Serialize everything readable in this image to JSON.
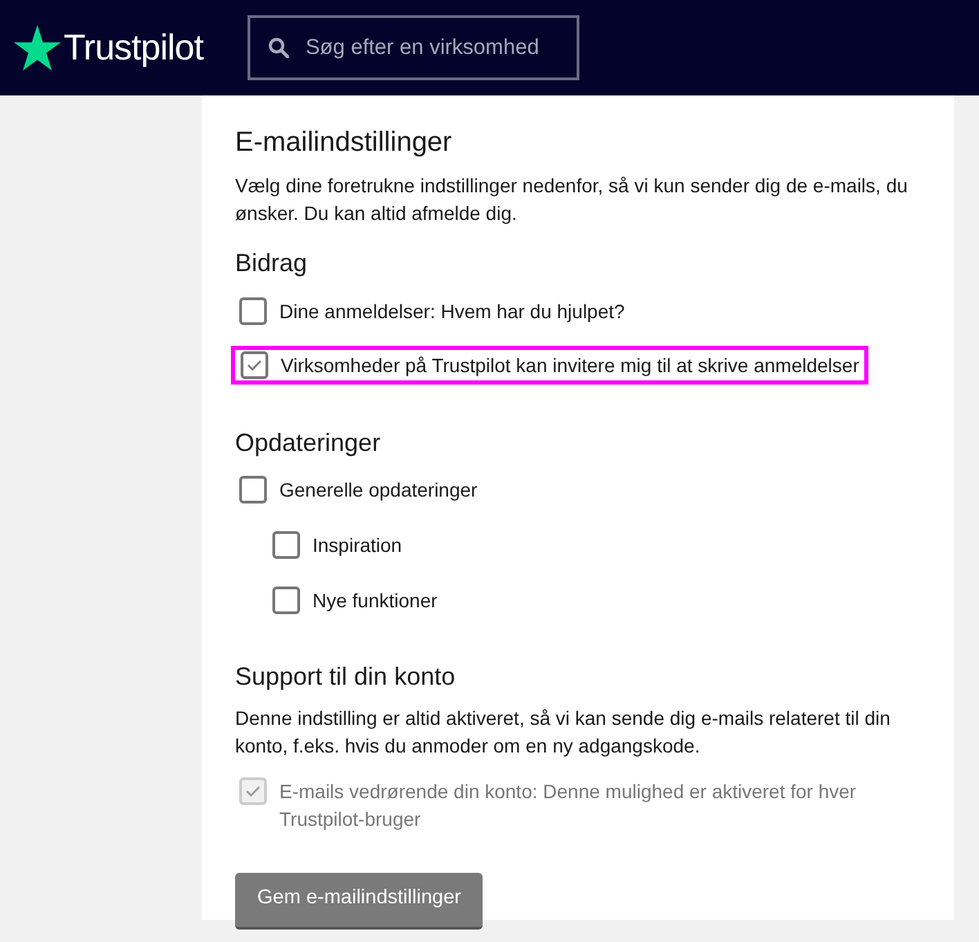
{
  "header": {
    "logo": "Trustpilot",
    "search": {
      "placeholder": "Søg efter en virksomhed"
    }
  },
  "page": {
    "title": "E-mailindstillinger",
    "intro": "Vælg dine foretrukne indstillinger nedenfor, så vi kun sender dig de e-mails, du ønsker. Du kan altid afmelde dig.",
    "sections": [
      {
        "heading": "Bidrag",
        "options": [
          {
            "label": "Dine anmeldelser: Hvem har du hjulpet?",
            "checked": false,
            "disabled": false,
            "highlighted": false
          },
          {
            "label": "Virksomheder på Trustpilot kan invitere mig til at skrive anmeldelser",
            "checked": true,
            "disabled": false,
            "highlighted": true
          }
        ]
      },
      {
        "heading": "Opdateringer",
        "options": [
          {
            "label": "Generelle opdateringer",
            "checked": false,
            "disabled": false,
            "highlighted": false,
            "children": [
              {
                "label": "Inspiration",
                "checked": false,
                "disabled": false,
                "highlighted": false
              },
              {
                "label": "Nye funktioner",
                "checked": false,
                "disabled": false,
                "highlighted": false
              }
            ]
          }
        ]
      },
      {
        "heading": "Support til din konto",
        "description": "Denne indstilling er altid aktiveret, så vi kan sende dig e-mails relateret til din konto, f.eks. hvis du anmoder om en ny adgangskode.",
        "options": [
          {
            "label": "E-mails vedrørende din konto: Denne mulighed er aktiveret for hver Trustpilot-bruger",
            "checked": true,
            "disabled": true,
            "highlighted": false
          }
        ]
      }
    ],
    "save_button": "Gem e-mailindstillinger"
  }
}
